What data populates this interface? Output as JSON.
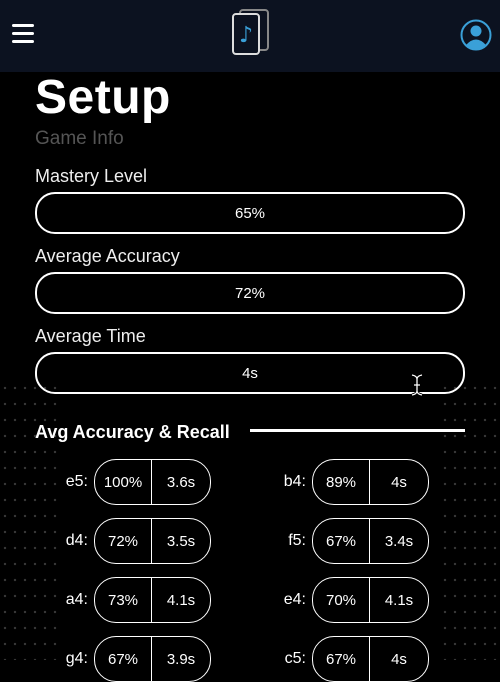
{
  "page": {
    "title": "Setup",
    "subtitle": "Game Info"
  },
  "fields": [
    {
      "label": "Mastery Level",
      "value": "65%"
    },
    {
      "label": "Average Accuracy",
      "value": "72%"
    },
    {
      "label": "Average Time",
      "value": "4s"
    }
  ],
  "section": {
    "title": "Avg Accuracy & Recall"
  },
  "notes": [
    {
      "note": "e5:",
      "accuracy": "100%",
      "time": "3.6s"
    },
    {
      "note": "b4:",
      "accuracy": "89%",
      "time": "4s"
    },
    {
      "note": "d4:",
      "accuracy": "72%",
      "time": "3.5s"
    },
    {
      "note": "f5:",
      "accuracy": "67%",
      "time": "3.4s"
    },
    {
      "note": "a4:",
      "accuracy": "73%",
      "time": "4.1s"
    },
    {
      "note": "e4:",
      "accuracy": "70%",
      "time": "4.1s"
    },
    {
      "note": "g4:",
      "accuracy": "67%",
      "time": "3.9s"
    },
    {
      "note": "c5:",
      "accuracy": "67%",
      "time": "4s"
    }
  ],
  "icons": {
    "menu": "hamburger-menu-icon",
    "logo": "music-note-cards-logo",
    "profile": "user-avatar-icon"
  },
  "colors": {
    "background": "#000000",
    "header": "#0c1220",
    "accent": "#3aa0d8",
    "subtitle": "#555555"
  }
}
